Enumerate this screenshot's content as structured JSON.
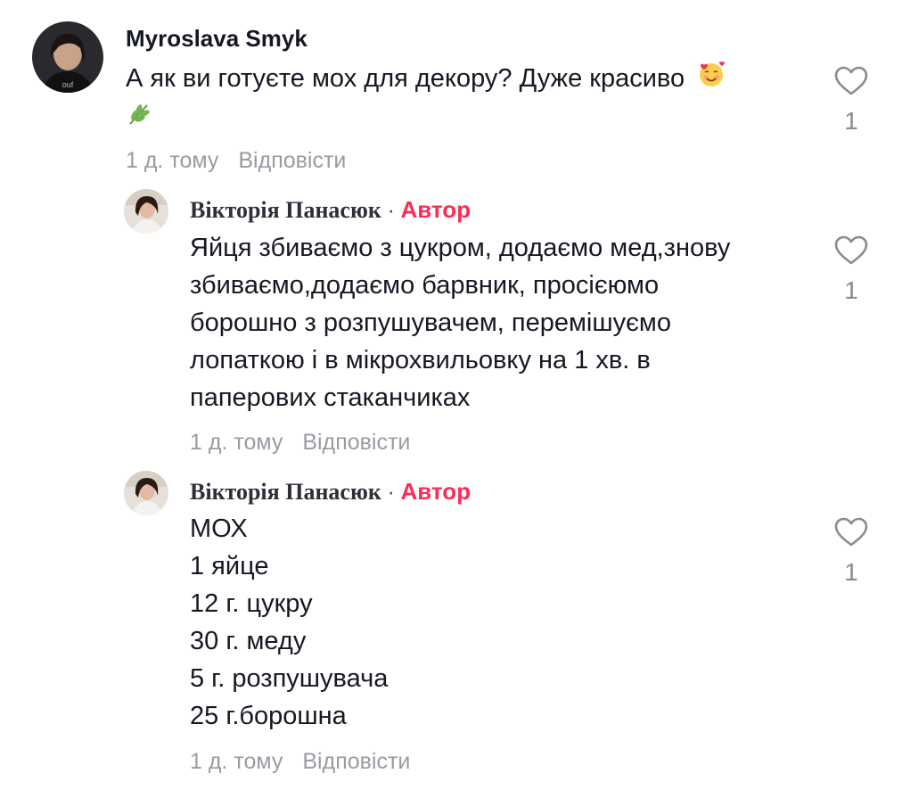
{
  "comments": [
    {
      "username": "Myroslava Smyk",
      "text_line1": "А як ви готуєте мох для декору? Дуже красиво",
      "emoji_1": "smiling-face-with-hearts",
      "emoji_2": "herb",
      "time": "1 д. тому",
      "reply_label": "Відповісти",
      "likes": "1"
    },
    {
      "username": "Вікторія Панасюк",
      "separator": "·",
      "author_label": "Автор",
      "lines": [
        "Яйця збиваємо з цукром, додаємо мед,знову",
        "збиваємо,додаємо барвник, просієюмо",
        "борошно з розпушувачем, перемішуємо",
        "лопаткою і в мікрохвильовку на 1 хв. в",
        "паперових стаканчиках"
      ],
      "time": "1 д. тому",
      "reply_label": "Відповісти",
      "likes": "1"
    },
    {
      "username": "Вікторія Панасюк",
      "separator": "·",
      "author_label": "Автор",
      "lines": [
        "МОХ",
        "1 яйце",
        "12 г. цукру",
        "30 г. меду",
        "5 г. розпушувача",
        "25 г.борошна"
      ],
      "time": "1 д. тому",
      "reply_label": "Відповісти",
      "likes": "1"
    }
  ],
  "colors": {
    "author_tag": "#fe2c55",
    "meta_text": "#9a9aa3",
    "primary_text": "#161823"
  },
  "icons": {
    "like": "heart-outline-icon"
  }
}
